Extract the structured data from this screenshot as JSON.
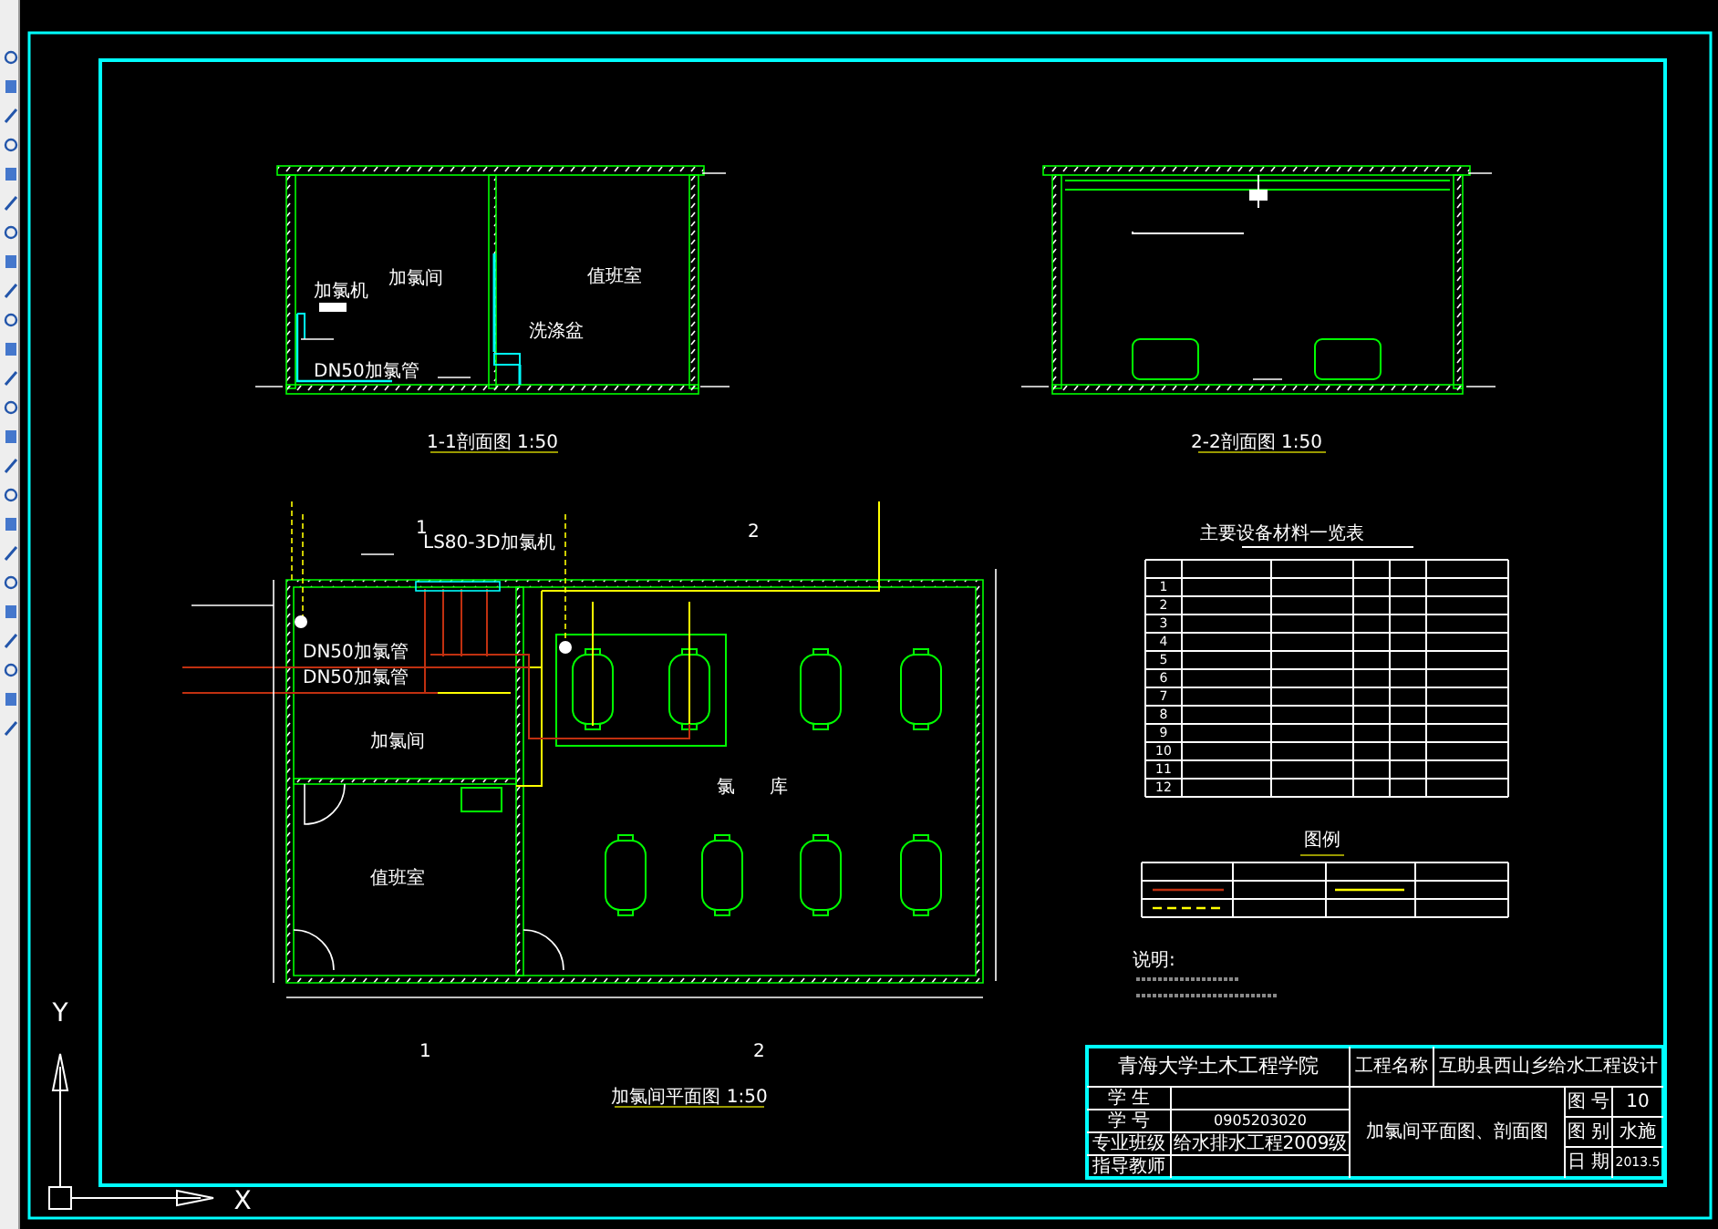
{
  "section_1": {
    "title": "1-1剖面图 1:50",
    "labels": [
      "加氯间",
      "值班室",
      "加氯机",
      "DN50加氯管",
      "洗涤盆"
    ]
  },
  "section_2": {
    "title": "2-2剖面图 1:50"
  },
  "plan": {
    "title": "加氯间平面图 1:50",
    "labels": [
      "DN50加氯管",
      "DN50加氯管",
      "加氯间",
      "值班室",
      "氯",
      "库",
      "LS80-3D加氯机"
    ],
    "section_marks": [
      "1",
      "2",
      "1",
      "2"
    ]
  },
  "equipment_table": {
    "title": "主要设备材料一览表",
    "row_numbers": [
      "1",
      "2",
      "3",
      "4",
      "5",
      "6",
      "7",
      "8",
      "9",
      "10",
      "11",
      "12"
    ]
  },
  "legend": {
    "title": "图例"
  },
  "notes": {
    "title": "说明:"
  },
  "title_block": {
    "school": "青海大学土木工程学院",
    "project_label": "工程名称",
    "project": "互助县西山乡给水工程设计",
    "drawing_name": "加氯间平面图、剖面图",
    "fields": [
      {
        "label": "学  生"
      },
      {
        "label": "学  号",
        "value": "0905203020"
      },
      {
        "label": "专业班级",
        "value": "给水排水工程2009级"
      },
      {
        "label": "指导教师"
      }
    ],
    "info": [
      {
        "label": "图 号",
        "value": "10"
      },
      {
        "label": "图 别",
        "value": "水施"
      },
      {
        "label": "日 期",
        "value": "2013.5"
      }
    ]
  },
  "ucs": {
    "x_label": "X",
    "y_label": "Y"
  }
}
